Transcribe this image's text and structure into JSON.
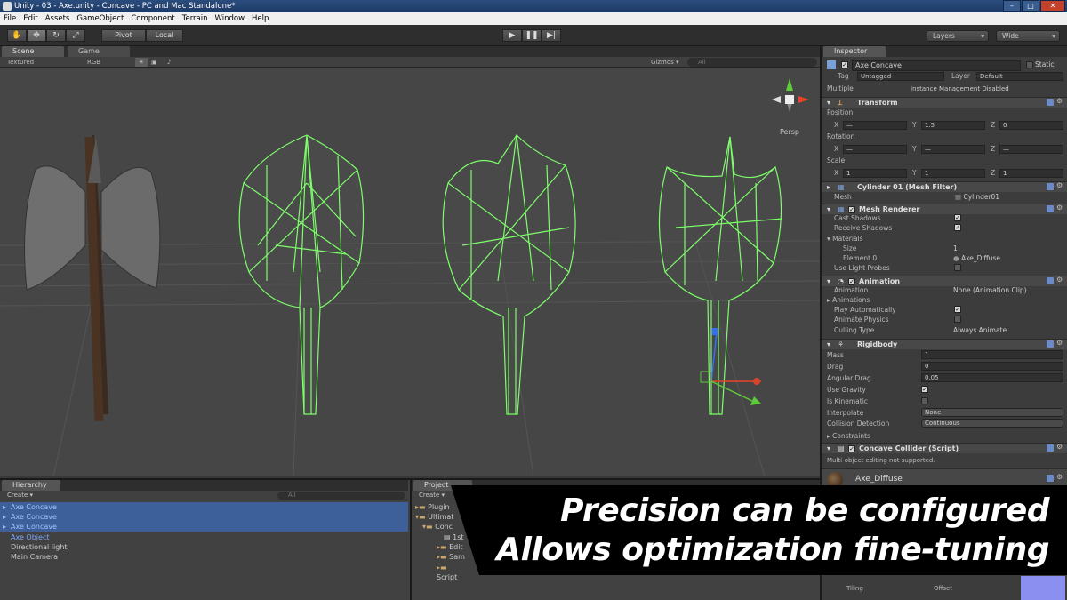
{
  "window": {
    "title": "Unity - 03 - Axe.unity - Concave - PC and Mac Standalone*"
  },
  "menu": [
    "File",
    "Edit",
    "Assets",
    "GameObject",
    "Component",
    "Terrain",
    "Window",
    "Help"
  ],
  "toolbar": {
    "pivot": "Pivot",
    "local": "Local",
    "layers": "Layers",
    "layout": "Wide"
  },
  "scene_tabs": {
    "scene": "Scene",
    "game": "Game"
  },
  "scene_bar": {
    "draw_mode": "Textured",
    "render_mode": "RGB",
    "gizmos": "Gizmos",
    "search_placeholder": "All"
  },
  "scene": {
    "projection": "Persp"
  },
  "inspector": {
    "tab": "Inspector",
    "object_name": "Axe Concave",
    "static_label": "Static",
    "tag_label": "Tag",
    "tag_value": "Untagged",
    "layer_label": "Layer",
    "layer_value": "Default",
    "multiple_label": "Multiple",
    "multiple_note": "Instance Management Disabled",
    "transform": {
      "title": "Transform",
      "position_label": "Position",
      "position": {
        "x": "—",
        "y": "1.5",
        "z": "0"
      },
      "rotation_label": "Rotation",
      "rotation": {
        "x": "—",
        "y": "—",
        "z": "—"
      },
      "scale_label": "Scale",
      "scale": {
        "x": "1",
        "y": "1",
        "z": "1"
      }
    },
    "mesh_filter": {
      "title": "Cylinder 01 (Mesh Filter)",
      "mesh_label": "Mesh",
      "mesh_value": "Cylinder01"
    },
    "mesh_renderer": {
      "title": "Mesh Renderer",
      "cast_shadows": "Cast Shadows",
      "receive_shadows": "Receive Shadows",
      "materials": "Materials",
      "size_label": "Size",
      "size_value": "1",
      "element0_label": "Element 0",
      "element0_value": "Axe_Diffuse",
      "use_light_probes": "Use Light Probes"
    },
    "animation": {
      "title": "Animation",
      "animation_label": "Animation",
      "animation_value": "None (Animation Clip)",
      "animations": "Animations",
      "play_auto": "Play Automatically",
      "animate_physics": "Animate Physics",
      "culling_label": "Culling Type",
      "culling_value": "Always Animate"
    },
    "rigidbody": {
      "title": "Rigidbody",
      "mass_label": "Mass",
      "mass": "1",
      "drag_label": "Drag",
      "drag": "0",
      "angular_drag_label": "Angular Drag",
      "angular_drag": "0.05",
      "use_gravity": "Use Gravity",
      "is_kinematic": "Is Kinematic",
      "interpolate_label": "Interpolate",
      "interpolate": "None",
      "collision_label": "Collision Detection",
      "collision": "Continuous",
      "constraints": "Constraints"
    },
    "concave_collider": {
      "title": "Concave Collider (Script)",
      "note": "Multi-object editing not supported."
    },
    "material": {
      "name": "Axe_Diffuse",
      "tiling": "Tiling",
      "offset": "Offset"
    }
  },
  "hierarchy": {
    "tab": "Hierarchy",
    "create": "Create",
    "search_placeholder": "All",
    "items": [
      "Axe Concave",
      "Axe Concave",
      "Axe Concave",
      "Axe Object",
      "Directional light",
      "Main Camera"
    ]
  },
  "project": {
    "tab": "Project",
    "create": "Create",
    "items": [
      "Plugin",
      "Ultimat",
      "Conc",
      "1st",
      "Edit",
      "Sam",
      "Script"
    ]
  },
  "caption": {
    "line1": "Precision can be configured",
    "line2": "Allows optimization fine-tuning"
  },
  "colors": {
    "wire": "#7dff6a",
    "selection": "#3d609a",
    "accent_blue": "#6a8bc8"
  }
}
